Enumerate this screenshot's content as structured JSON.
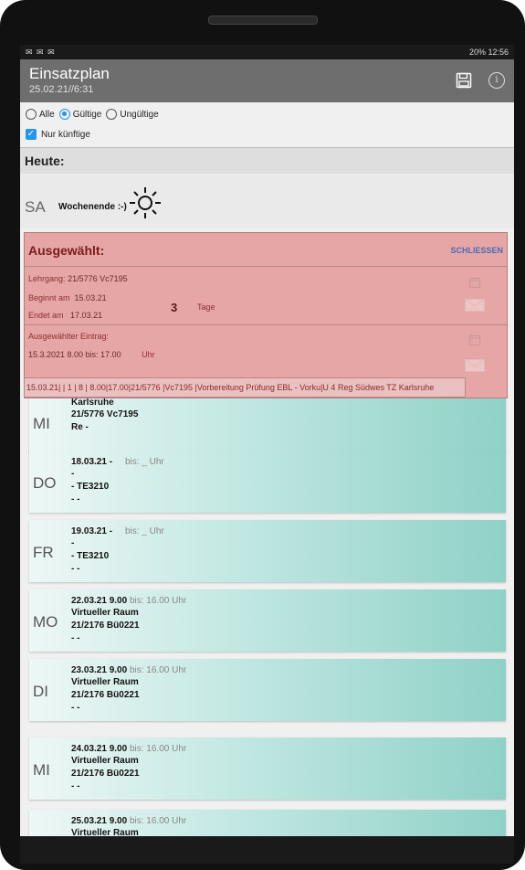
{
  "statusbar": {
    "left": "✉ ✉ ✉",
    "right": "20% 12:56"
  },
  "appbar": {
    "title": "Einsatzplan",
    "subtitle": "25.02.21//6:31"
  },
  "filter": {
    "alle": "Alle",
    "gueltige": "Gültige",
    "ungueltige": "Ungültige",
    "nur_kuenftige": "Nur künftige"
  },
  "heute": {
    "label": "Heute:",
    "day": "SA",
    "text": "Wochenende :-)"
  },
  "selected": {
    "title": "Ausgewählt:",
    "close": "SCHLIESSEN",
    "lehrgang_label": "Lehrgang:",
    "lehrgang_value": "21/5776  Vc7195",
    "beginnt_label": "Beginnt am",
    "beginnt_value": "15.03.21",
    "endet_label": "Endet am",
    "endet_value": "17.03.21",
    "tage_num": "3",
    "tage_label": "Tage",
    "eintrag_label": "Ausgewählter Eintrag:",
    "eintrag_value": "15.3.2021  8.00  bis:  17.00",
    "eintrag_uhr": "Uhr",
    "info": "15.03.21| | 1 | 8 | 8.00|17.00|21/5776 |Vc7195 |Vorbereitung Prüfung EBL - Vorku|U 4 Reg Südwes TZ Karlsruhe"
  },
  "cards": [
    {
      "day": "MI",
      "l1": "Karlsruhe",
      "l1b": "",
      "l2": "21/5776     Vc7195",
      "l3": "Re   -",
      "l4": ""
    },
    {
      "day": "DO",
      "l1": "18.03.21  -",
      "l1b": "bis: _      Uhr",
      "l2": "-",
      "l3": "-                TE3210",
      "l4": "-      -"
    },
    {
      "day": "FR",
      "l1": "19.03.21  -",
      "l1b": "bis: _      Uhr",
      "l2": "-",
      "l3": "-                TE3210",
      "l4": "-      -"
    },
    {
      "day": "MO",
      "l1": "22.03.21  9.00",
      "l1b": "bis: 16.00 Uhr",
      "l2": "Virtueller Raum",
      "l3": "21/2176      Bü0221",
      "l4": "-      -"
    },
    {
      "day": "DI",
      "l1": "23.03.21  9.00",
      "l1b": "bis: 16.00 Uhr",
      "l2": "Virtueller Raum",
      "l3": "21/2176      Bü0221",
      "l4": "-      -"
    },
    {
      "day": "MI",
      "l1": "24.03.21  9.00",
      "l1b": "bis: 16.00 Uhr",
      "l2": "Virtueller Raum",
      "l3": "21/2176      Bü0221",
      "l4": "-      -"
    },
    {
      "day": "",
      "l1": "25.03.21  9.00",
      "l1b": "bis: 16.00 Uhr",
      "l2": "Virtueller Raum",
      "l3": "",
      "l4": ""
    }
  ]
}
